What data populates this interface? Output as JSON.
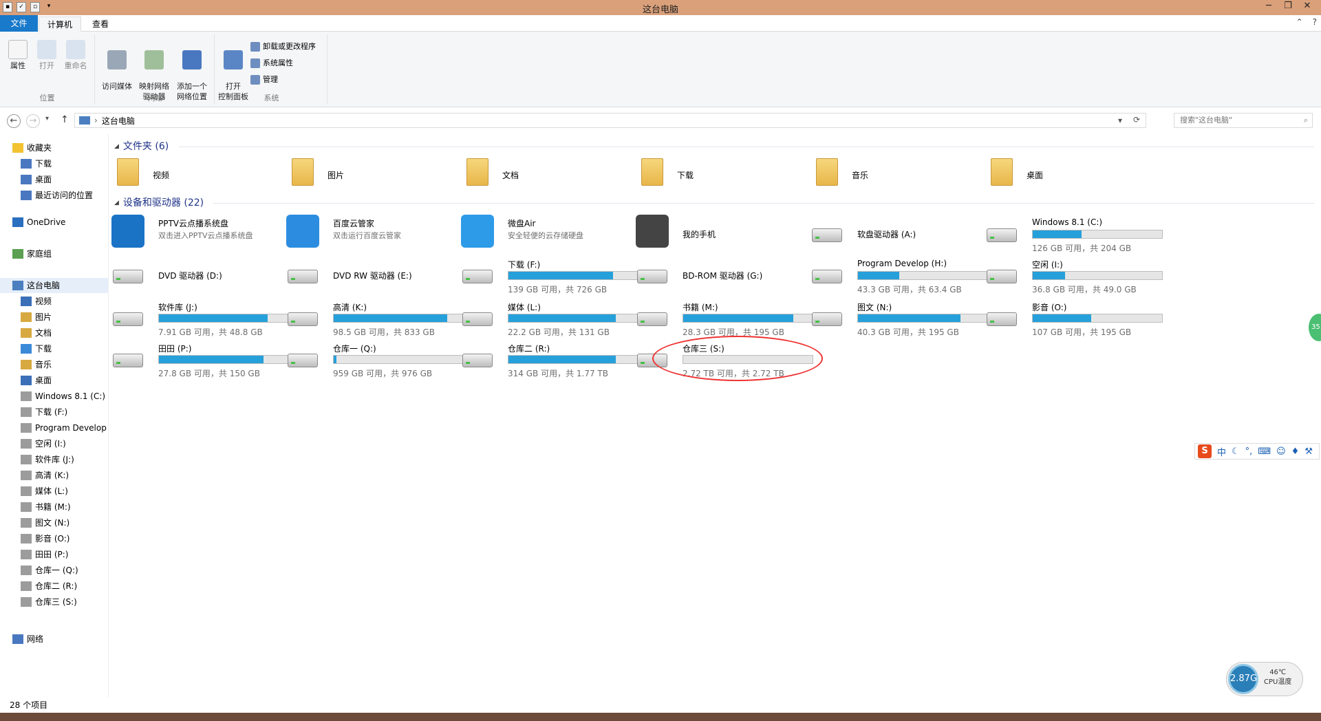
{
  "window": {
    "title": "这台电脑"
  },
  "tabs": {
    "file": "文件",
    "computer": "计算机",
    "view": "查看"
  },
  "ribbon": {
    "location": {
      "label": "位置",
      "properties": "属性",
      "open": "打开",
      "rename": "重命名"
    },
    "network": {
      "label": "网络",
      "media": "访问媒体",
      "map_drive": "映射网络\n驱动器",
      "add_location": "添加一个\n网络位置"
    },
    "system": {
      "label": "系统",
      "control_panel": "打开\n控制面板",
      "uninstall": "卸载或更改程序",
      "sys_props": "系统属性",
      "manage": "管理"
    }
  },
  "address": {
    "path": "这台电脑",
    "search_placeholder": "搜索\"这台电脑\""
  },
  "sidebar": {
    "favorites": "收藏夹",
    "fav_items": [
      "下载",
      "桌面",
      "最近访问的位置"
    ],
    "onedrive": "OneDrive",
    "homegroup": "家庭组",
    "thispc": "这台电脑",
    "pc_items": [
      "视频",
      "图片",
      "文档",
      "下载",
      "音乐",
      "桌面",
      "Windows 8.1 (C:)",
      "下载 (F:)",
      "Program Develop",
      "空闲 (I:)",
      "软件库 (J:)",
      "高清 (K:)",
      "媒体 (L:)",
      "书籍 (M:)",
      "图文 (N:)",
      "影音 (O:)",
      "田田 (P:)",
      "仓库一 (Q:)",
      "仓库二 (R:)",
      "仓库三 (S:)"
    ],
    "network": "网络"
  },
  "sections": {
    "folders": "文件夹 (6)",
    "devices": "设备和驱动器 (22)"
  },
  "folders": [
    "视频",
    "图片",
    "文档",
    "下载",
    "音乐",
    "桌面"
  ],
  "apps": [
    {
      "name": "PPTV云点播系统盘",
      "sub": "双击进入PPTV云点播系统盘"
    },
    {
      "name": "百度云管家",
      "sub": "双击运行百度云管家"
    },
    {
      "name": "微盘Air",
      "sub": "安全轻便的云存储硬盘"
    },
    {
      "name": "我的手机",
      "sub": ""
    },
    {
      "name": "软盘驱动器 (A:)",
      "sub": ""
    }
  ],
  "drives": [
    {
      "name": "Windows 8.1 (C:)",
      "free": "126 GB 可用，共 204 GB",
      "used": 0.38
    },
    {
      "name": "DVD 驱动器 (D:)",
      "free": "",
      "used": null
    },
    {
      "name": "DVD RW 驱动器 (E:)",
      "free": "",
      "used": null
    },
    {
      "name": "下载 (F:)",
      "free": "139 GB 可用，共 726 GB",
      "used": 0.81
    },
    {
      "name": "BD-ROM 驱动器 (G:)",
      "free": "",
      "used": null
    },
    {
      "name": "Program Develop (H:)",
      "free": "43.3 GB 可用，共 63.4 GB",
      "used": 0.32
    },
    {
      "name": "空闲 (I:)",
      "free": "36.8 GB 可用，共 49.0 GB",
      "used": 0.25
    },
    {
      "name": "软件库 (J:)",
      "free": "7.91 GB 可用，共 48.8 GB",
      "used": 0.84
    },
    {
      "name": "高清 (K:)",
      "free": "98.5 GB 可用，共 833 GB",
      "used": 0.88
    },
    {
      "name": "媒体 (L:)",
      "free": "22.2 GB 可用，共 131 GB",
      "used": 0.83
    },
    {
      "name": "书籍 (M:)",
      "free": "28.3 GB 可用，共 195 GB",
      "used": 0.85
    },
    {
      "name": "图文 (N:)",
      "free": "40.3 GB 可用，共 195 GB",
      "used": 0.79
    },
    {
      "name": "影音 (O:)",
      "free": "107 GB 可用，共 195 GB",
      "used": 0.45
    },
    {
      "name": "田田 (P:)",
      "free": "27.8 GB 可用，共 150 GB",
      "used": 0.81
    },
    {
      "name": "仓库一 (Q:)",
      "free": "959 GB 可用，共 976 GB",
      "used": 0.02
    },
    {
      "name": "仓库二 (R:)",
      "free": "314 GB 可用，共 1.77 TB",
      "used": 0.83
    },
    {
      "name": "仓库三 (S:)",
      "free": "2.72 TB 可用，共 2.72 TB",
      "used": 0.0
    }
  ],
  "status": {
    "count": "28 个项目"
  },
  "ime": {
    "lang": "中"
  },
  "gauge": {
    "freq": "2.87G",
    "temp": "46℃",
    "label": "CPU温度"
  },
  "edge_badge": "35",
  "colors": {
    "accent": "#1979ca",
    "bar": "#26a0da",
    "title": "#d9a07a",
    "section": "#1e3287"
  }
}
